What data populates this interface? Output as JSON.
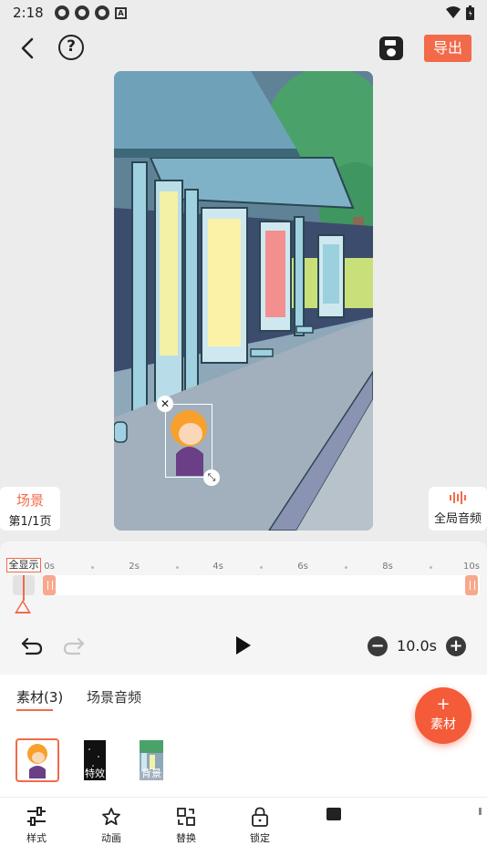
{
  "status": {
    "time": "2:18",
    "notif_letter": "A"
  },
  "toolbar": {
    "help": "?",
    "export_label": "导出"
  },
  "scene": {
    "title": "场景",
    "page": "第1/1页"
  },
  "global_audio": {
    "label": "全局音频"
  },
  "timeline": {
    "full_show": "全显示",
    "ticks": [
      "0s",
      "2s",
      "4s",
      "6s",
      "8s",
      "10s"
    ],
    "duration": "10.0s"
  },
  "panel": {
    "tabs": [
      "素材(3)",
      "场景音频"
    ],
    "add_plus": "+",
    "add_label": "素材",
    "thumb_labels": [
      "特效",
      "背景"
    ]
  },
  "tools": [
    "样式",
    "动画",
    "替换",
    "锁定"
  ],
  "colors": {
    "accent": "#f26a4a",
    "canvas_sky": "#a9bccb"
  }
}
